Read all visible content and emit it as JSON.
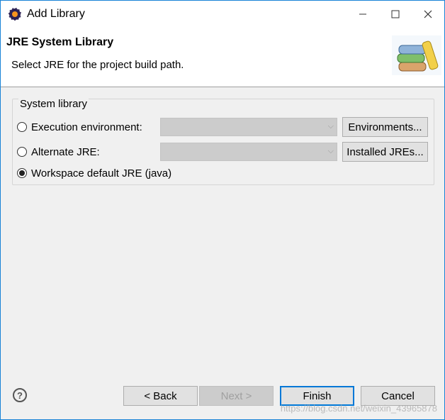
{
  "window": {
    "title": "Add Library"
  },
  "banner": {
    "title": "JRE System Library",
    "description": "Select JRE for the project build path."
  },
  "group": {
    "label": "System library",
    "options": [
      {
        "label": "Execution environment:",
        "checked": false,
        "button": "Environments..."
      },
      {
        "label": "Alternate JRE:",
        "checked": false,
        "button": "Installed JREs..."
      },
      {
        "label": "Workspace default JRE (java)",
        "checked": true
      }
    ]
  },
  "footer": {
    "back": "< Back",
    "next": "Next >",
    "finish": "Finish",
    "cancel": "Cancel"
  },
  "watermark": "https://blog.csdn.net/weixin_43965878",
  "colors": {
    "accent": "#0078d7",
    "border": "#1883d7"
  }
}
